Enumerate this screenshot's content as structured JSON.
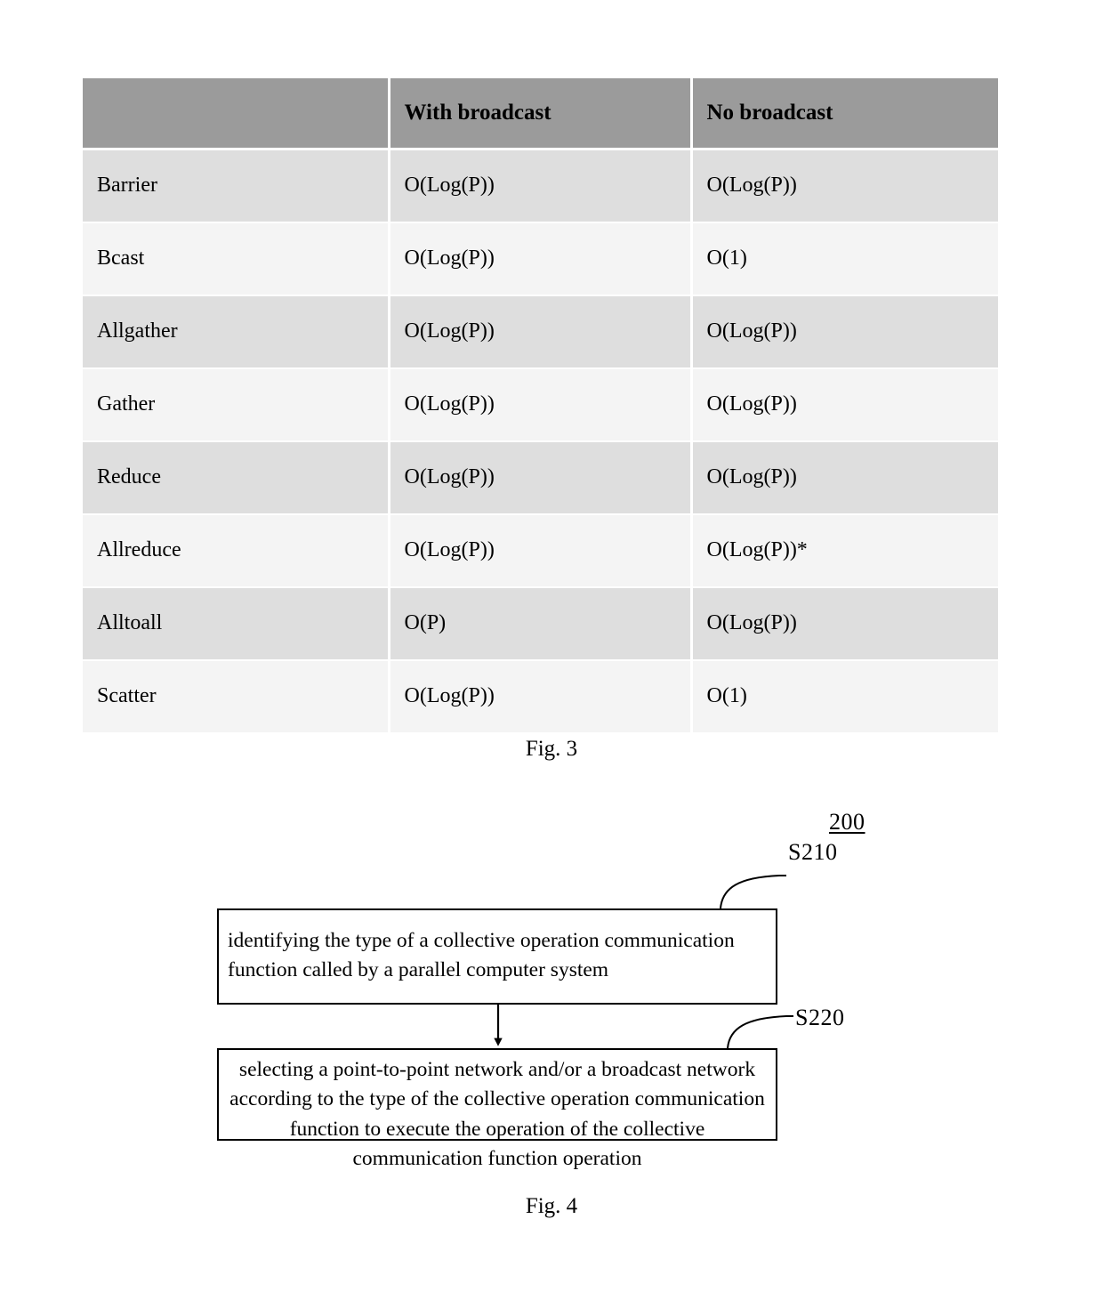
{
  "figures": {
    "fig3": {
      "caption": "Fig. 3",
      "table": {
        "headers": [
          "",
          "With broadcast",
          "No broadcast"
        ],
        "rows": [
          {
            "operation": "Barrier",
            "with_broadcast": "O(Log(P))",
            "no_broadcast": "O(Log(P))"
          },
          {
            "operation": "Bcast",
            "with_broadcast": "O(Log(P))",
            "no_broadcast": "O(1)"
          },
          {
            "operation": "Allgather",
            "with_broadcast": "O(Log(P))",
            "no_broadcast": "O(Log(P))"
          },
          {
            "operation": "Gather",
            "with_broadcast": "O(Log(P))",
            "no_broadcast": "O(Log(P))"
          },
          {
            "operation": "Reduce",
            "with_broadcast": "O(Log(P))",
            "no_broadcast": "O(Log(P))"
          },
          {
            "operation": "Allreduce",
            "with_broadcast": "O(Log(P))",
            "no_broadcast": "O(Log(P))*"
          },
          {
            "operation": "Alltoall",
            "with_broadcast": "O(P)",
            "no_broadcast": "O(Log(P))"
          },
          {
            "operation": "Scatter",
            "with_broadcast": "O(Log(P))",
            "no_broadcast": "O(1)"
          }
        ]
      }
    },
    "fig4": {
      "caption": "Fig. 4",
      "method_reference": "200",
      "steps": [
        {
          "reference": "S210",
          "text": "identifying the type of a collective operation communication function called by a parallel computer system"
        },
        {
          "reference": "S220",
          "text": "selecting a point-to-point network and/or a broadcast network according to the type of the collective operation communication function to execute the operation of the collective communication function operation"
        }
      ]
    }
  },
  "colors": {
    "header_fill": "#9b9b9b",
    "row_shaded_fill": "#dedede",
    "row_plain_fill": "#f4f4f4",
    "line": "#000000",
    "page_background": "#ffffff"
  }
}
